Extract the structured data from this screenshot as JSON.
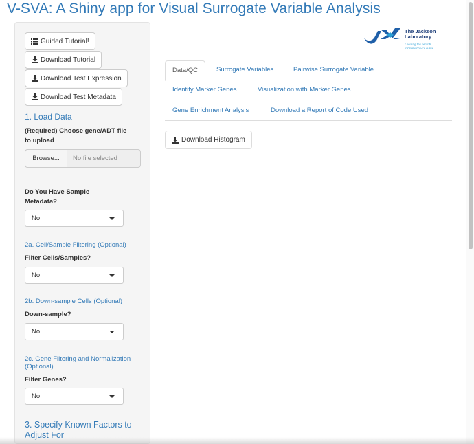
{
  "app": {
    "title": "V-SVA: A Shiny app for Visual Surrogate Variable Analysis"
  },
  "logo": {
    "line1": "The Jackson",
    "line2": "Laboratory",
    "tagline1": "Leading the search",
    "tagline2": "for tomorrow's cures",
    "color": "#1f5fa8"
  },
  "sidebar": {
    "buttons": {
      "guided_tutorial": "Guided Tutorial!",
      "download_tutorial": "Download Tutorial",
      "download_test_expression": "Download Test Expression",
      "download_test_metadata": "Download Test Metadata"
    },
    "load_data": {
      "heading": "1. Load Data",
      "file_label_line1": "(Required) Choose gene/ADT file",
      "file_label_line2": "to upload",
      "browse_label": "Browse...",
      "file_placeholder": "No file selected"
    },
    "sample_metadata": {
      "label_line1": "Do You Have Sample",
      "label_line2": "Metadata?",
      "value": "No"
    },
    "cell_filtering": {
      "heading": "2a. Cell/Sample Filtering (Optional)",
      "label": "Filter Cells/Samples?",
      "value": "No"
    },
    "downsample": {
      "heading": "2b. Down-sample Cells (Optional)",
      "label": "Down-sample?",
      "value": "No"
    },
    "gene_filtering": {
      "heading_line1": "2c. Gene Filtering and Normalization",
      "heading_line2": "(Optional)",
      "label": "Filter Genes?",
      "value": "No"
    },
    "known_factors": {
      "heading_line1": "3. Specify Known Factors to",
      "heading_line2": "Adjust For"
    }
  },
  "main": {
    "tabs": [
      {
        "label": "Data/QC",
        "active": true
      },
      {
        "label": "Surrogate Variables",
        "active": false
      },
      {
        "label": "Pairwise Surrogate Variable",
        "active": false
      },
      {
        "label": "Identify Marker Genes",
        "active": false
      },
      {
        "label": "Visualization with Marker Genes",
        "active": false
      },
      {
        "label": "Gene Enrichment Analysis",
        "active": false
      },
      {
        "label": "Download a Report of Code Used",
        "active": false
      }
    ],
    "download_histogram": "Download Histogram"
  },
  "colors": {
    "accent": "#337ab7",
    "sidebar_bg": "#f5f5f5"
  },
  "icons": {
    "list": "list-icon",
    "download": "download-icon",
    "caret": "caret-down-icon"
  }
}
